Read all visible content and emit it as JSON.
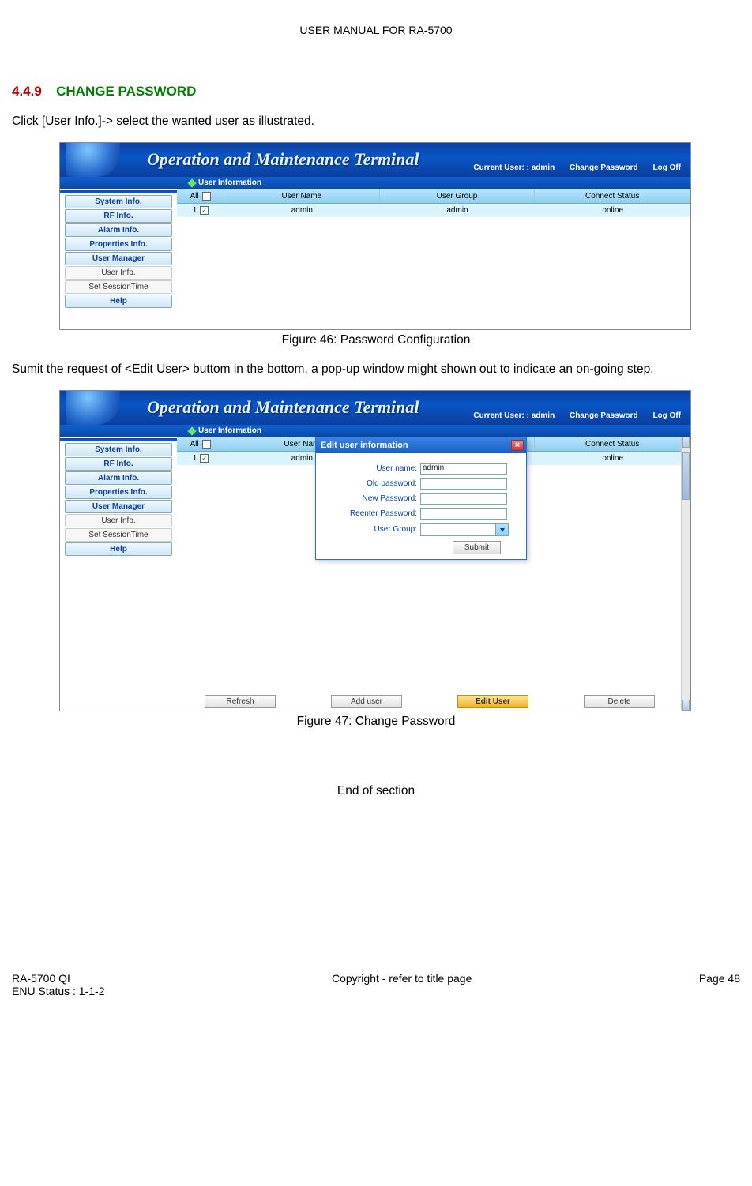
{
  "page_header": "USER MANUAL FOR RA-5700",
  "section": {
    "number": "4.4.9",
    "title": "CHANGE PASSWORD"
  },
  "paragraph1": "Click [User Info.]-> select the wanted user as illustrated.",
  "paragraph2": "Sumit the request of <Edit User> buttom in the bottom, a pop-up window might shown out to indicate an on-going step.",
  "figure1_caption": "Figure 46: Password Configuration",
  "figure2_caption": "Figure 47: Change Password",
  "end_text": "End of section",
  "banner": {
    "title": "Operation and Maintenance Terminal",
    "current_user_label": "Current User: : admin",
    "change_password": "Change Password",
    "log_off": "Log Off"
  },
  "subheader": "User Information",
  "sidebar": {
    "items_bold": [
      "System Info.",
      "RF Info.",
      "Alarm Info.",
      "Properties Info.",
      "User Manager"
    ],
    "items_plain": [
      "User Info.",
      "Set SessionTime"
    ],
    "help": "Help"
  },
  "table": {
    "header": {
      "all": "All",
      "user": "User Name",
      "group": "User Group",
      "status": "Connect Status"
    },
    "row": {
      "idx": "1",
      "user": "admin",
      "group": "admin",
      "status": "online",
      "checked": true
    }
  },
  "dialog": {
    "title": "Edit user information",
    "labels": {
      "user_name": "User   name:",
      "old_password": "Old   password:",
      "new_password": "New   Password:",
      "reenter_password": "Reenter   Password:",
      "user_group": "User     Group:"
    },
    "user_name_value": "admin",
    "submit": "Submit"
  },
  "actions": {
    "refresh": "Refresh",
    "add_user": "Add user",
    "edit_user": "Edit User",
    "delete": "Delete"
  },
  "footer": {
    "left1": "RA-5700 QI",
    "left2": "ENU Status : 1-1-2",
    "mid": "Copyright - refer to title page",
    "right": "Page 48"
  }
}
